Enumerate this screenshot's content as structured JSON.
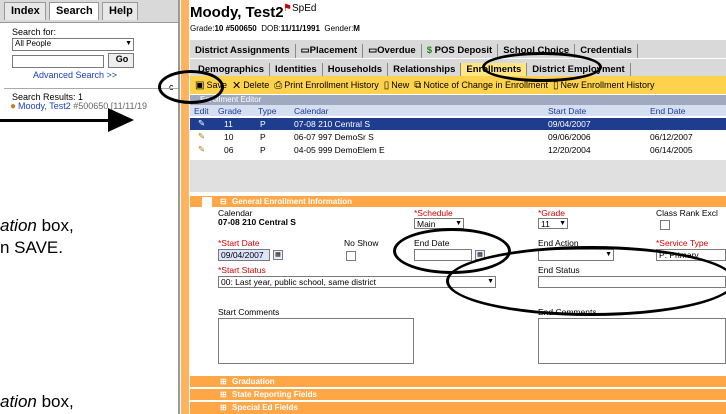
{
  "left_panel": {
    "tabs": [
      {
        "label": "Index"
      },
      {
        "label": "Search"
      },
      {
        "label": "Help"
      }
    ],
    "search_for_label": "Search for:",
    "search_for_value": "All People",
    "go_label": "Go",
    "advanced_search_label": "Advanced Search >>",
    "results_label": "Search Results: 1",
    "result_name": "Moody, Test2",
    "result_detail": "#500650 [11/11/19",
    "c_fragment": "c"
  },
  "student": {
    "name": "Moody, Test2",
    "sped_flag": "SpEd",
    "grade_label": "Grade:",
    "grade": "10",
    "id": "#500650",
    "dob_label": "DOB:",
    "dob": "11/11/1991",
    "gender_label": "Gender:",
    "gender": "M"
  },
  "tabs_row1": [
    {
      "label": "District Assignments"
    },
    {
      "label": "Placement"
    },
    {
      "label": "Overdue"
    },
    {
      "label": "POS Deposit"
    },
    {
      "label": "School Choice"
    },
    {
      "label": "Credentials"
    }
  ],
  "tabs_row2": [
    {
      "label": "Demographics"
    },
    {
      "label": "Identities"
    },
    {
      "label": "Households"
    },
    {
      "label": "Relationships"
    },
    {
      "label": "Enrollments"
    },
    {
      "label": "District Employment"
    }
  ],
  "toolbar": {
    "save": "Save",
    "delete": "Delete",
    "print_history": "Print Enrollment History",
    "new": "New",
    "notice": "Notice of Change in Enrollment",
    "new_history": "New Enrollment History"
  },
  "editor_title": "Enrollment Editor",
  "grid": {
    "headers": [
      "Edit",
      "Grade",
      "Type",
      "Calendar",
      "Start Date",
      "End Date"
    ],
    "rows": [
      {
        "grade": "11",
        "type": "P",
        "calendar": "07-08 210 Central S",
        "start": "09/04/2007",
        "end": ""
      },
      {
        "grade": "10",
        "type": "P",
        "calendar": "06-07 997 DemoSr S",
        "start": "09/06/2006",
        "end": "06/12/2007"
      },
      {
        "grade": "06",
        "type": "P",
        "calendar": "04-05 999 DemoElem E",
        "start": "12/20/2004",
        "end": "06/14/2005"
      }
    ]
  },
  "general_section": {
    "title": "General Enrollment Information",
    "calendar_label": "Calendar",
    "calendar_value": "07-08 210 Central S",
    "schedule_label": "*Schedule",
    "schedule_value": "Main",
    "grade_label": "*Grade",
    "grade_value": "11",
    "class_rank_label": "Class Rank Excl",
    "start_date_label": "*Start Date",
    "start_date_value": "09/04/2007",
    "no_show_label": "No Show",
    "end_date_label": "End Date",
    "end_date_value": "",
    "end_action_label": "End Action",
    "service_type_label": "*Service Type",
    "service_type_value": "P: Primary",
    "start_status_label": "*Start Status",
    "start_status_value": "00: Last year, public school, same district",
    "end_status_label": "End Status",
    "start_comments_label": "Start Comments",
    "end_comments_label": "End Comments"
  },
  "collapsed_sections": [
    {
      "title": "Graduation"
    },
    {
      "title": "State Reporting Fields"
    },
    {
      "title": "Special Ed Fields"
    }
  ],
  "annotations": {
    "line1_italic": "ation",
    "line1_rest": " box,",
    "line2": "n SAVE.",
    "line3_italic": "ation",
    "line3_rest": " box,"
  },
  "colors": {
    "accent_orange": "#ffb35c",
    "toolbar_yellow": "#ffd24d",
    "selected_row": "#1f3d8f",
    "required_red": "#d40000"
  }
}
